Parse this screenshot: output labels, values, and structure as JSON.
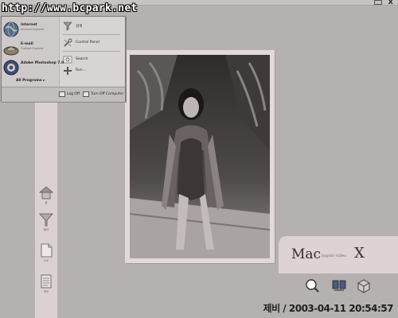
{
  "window": {
    "controls": [
      "restore-icon",
      "close-icon"
    ],
    "close_glyph": "x"
  },
  "watermark": "http://www.bcpark.net",
  "start_menu": {
    "programs": [
      {
        "title": "Internet",
        "subtitle": "Internet Explorer",
        "icon": "globe-icon"
      },
      {
        "title": "E-mail",
        "subtitle": "Outlook Express",
        "icon": "mail-icon"
      },
      {
        "title": "Adobe Photoshop 7.0",
        "subtitle": "",
        "icon": "photoshop-icon"
      }
    ],
    "all_programs": "All Programs",
    "right_items": [
      {
        "label": "검색",
        "icon": "search-icon"
      },
      {
        "label": "Control Panel",
        "icon": "control-panel-icon"
      },
      {
        "label": "Search",
        "icon": "search-icon"
      },
      {
        "label": "Run...",
        "icon": "run-icon"
      }
    ],
    "footer": {
      "log_off": "Log Off",
      "turn_off": "Turn Off Computer"
    }
  },
  "dock": [
    {
      "label": "홈",
      "icon": "home-icon"
    },
    {
      "label": "필터",
      "icon": "filter-icon"
    },
    {
      "label": "노트",
      "icon": "note-icon"
    },
    {
      "label": "메모",
      "icon": "memo-icon"
    }
  ],
  "mac_logo": {
    "word": "Mac",
    "subtitle": "tagstn video",
    "x": "X"
  },
  "tray": [
    {
      "label": "",
      "icon": "chat-search-icon"
    },
    {
      "label": "",
      "icon": "network-icon"
    },
    {
      "label": "",
      "icon": "box-icon"
    }
  ],
  "clock": "제비 / 2003-04-11 20:54:57",
  "colors": {
    "desktop": "#b6b1b1",
    "panel": "#ddd3d3",
    "strip": "#dcd1d1",
    "menu": "#d8d4d4"
  }
}
